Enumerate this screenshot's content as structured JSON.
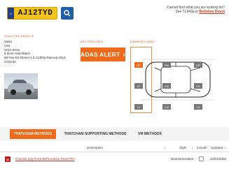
{
  "vehicle": {
    "reg": "AJ12TYD",
    "selected_label": "SELECTED VEHICLE",
    "details": [
      "Volvo",
      "V40",
      "2012-2016",
      "5 Door Hatchback",
      "98 Nov D2 Diesel 1.6 113bhp Manual 2012",
      "VO3733"
    ]
  },
  "header": {
    "note_line1": "Cannot find what you are looking for?",
    "note_prefix": "See TL849p in ",
    "note_link": "Bulletins Direct"
  },
  "features": {
    "label": "KEY FEATURES",
    "adas_label": "ADAS ALERT",
    "adas_chevron": "›"
  },
  "damaged": {
    "label": "DAMAGED AREA",
    "zones": [
      {
        "code": "RF",
        "active": true
      },
      {
        "code": "RM",
        "active": false
      },
      {
        "code": "RR",
        "active": false
      },
      {
        "code": "CF",
        "active": false
      },
      {
        "code": "CM",
        "active": false
      },
      {
        "code": "CR",
        "active": false
      },
      {
        "code": "LF",
        "active": false
      },
      {
        "code": "LM",
        "active": false
      },
      {
        "code": "LR",
        "active": false
      }
    ]
  },
  "tabs": [
    {
      "label": "THATCHAM METHODS",
      "active": true
    },
    {
      "label": "THATCHAM SUPPORTING METHODS",
      "active": false
    },
    {
      "label": "VM METHODS",
      "active": false
    }
  ],
  "table": {
    "headers": {
      "description": "Description",
      "sort_icon": "↕",
      "style": "Style",
      "include": "Include",
      "updated": "Updated"
    },
    "rows": [
      {
        "title": "Chassis Leg Front Deformation Panel RH",
        "style": "NextGeneration",
        "updated": "14/01/2016"
      }
    ]
  },
  "colors": {
    "accent": "#f06a1a",
    "plate": "#f3c21c",
    "button": "#1f5fa8"
  },
  "icons": {
    "search": "search-icon",
    "pdf": "pdf-icon",
    "car_topview": "car-topview-icon",
    "flag": "eu-flag-icon"
  }
}
